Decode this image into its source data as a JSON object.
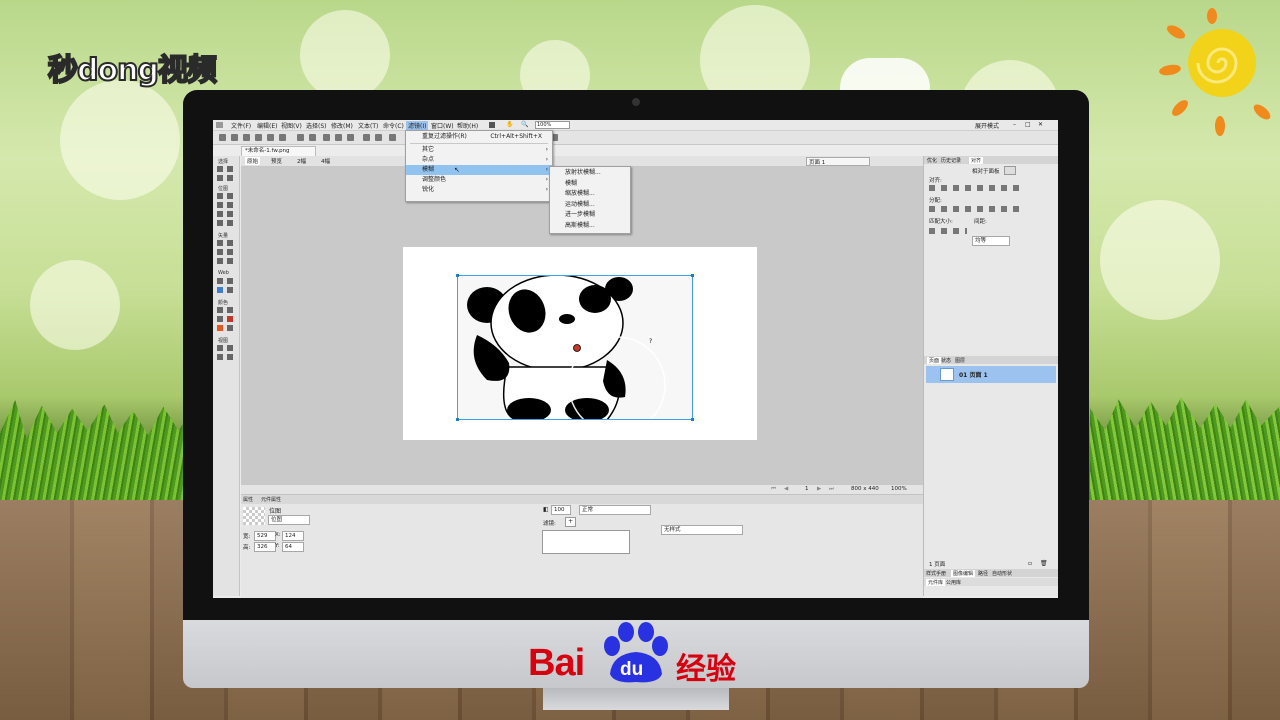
{
  "watermark": {
    "brand_left": "秒dong视频",
    "baidu": "Bai",
    "baidu_du": "du",
    "baidu_suffix": "经验"
  },
  "menubar": {
    "items": [
      "文件(F)",
      "编辑(E)",
      "视图(V)",
      "选择(S)",
      "修改(M)",
      "文本(T)",
      "命令(C)",
      "滤镜(I)",
      "窗口(W)",
      "帮助(H)"
    ],
    "zoom_value": "100%",
    "workspace": "展开模式"
  },
  "document": {
    "tab_title": "*未命名-1.fw.png",
    "view_tabs": [
      "原始",
      "预览",
      "2幅",
      "4幅"
    ],
    "page_label": "页面 1"
  },
  "tools": {
    "sections": [
      "选择",
      "位图",
      "矢量",
      "Web",
      "颜色",
      "视图"
    ]
  },
  "filter_menu": {
    "items": [
      {
        "label": "重复过滤操作(R)",
        "shortcut": "Ctrl+Alt+Shift+X",
        "submenu": false
      },
      {
        "label": "其它",
        "shortcut": "",
        "submenu": true
      },
      {
        "label": "杂点",
        "shortcut": "",
        "submenu": true
      },
      {
        "label": "模糊",
        "shortcut": "",
        "submenu": true,
        "active": true
      },
      {
        "label": "调整颜色",
        "shortcut": "",
        "submenu": true
      },
      {
        "label": "锐化",
        "shortcut": "",
        "submenu": true
      }
    ]
  },
  "blur_submenu": {
    "items": [
      "放射状模糊...",
      "模糊",
      "缩放模糊...",
      "运动模糊...",
      "进一步模糊",
      "高斯模糊..."
    ]
  },
  "status": {
    "page_num": "1",
    "canvas_size": "800 x 440",
    "zoom": "100%"
  },
  "properties": {
    "tabs": [
      "属性",
      "元件属性"
    ],
    "object_type": "位图",
    "object_name": "位图",
    "width_label": "宽:",
    "width": "529",
    "height_label": "高:",
    "height": "326",
    "x_label": "X:",
    "x": "124",
    "y_label": "Y:",
    "y": "64",
    "opacity": "100",
    "blend_mode": "正常",
    "filters_label": "滤镜:",
    "style": "无样式"
  },
  "right_panel": {
    "top_tabs": [
      "优化",
      "历史记录",
      "对齐"
    ],
    "relative_to": "相对于面板",
    "align_label": "对齐:",
    "distribute_label": "分配:",
    "match_size_label": "匹配大小:",
    "spacing_label": "间距:",
    "spacing_value": "均等",
    "pages_tabs": [
      "页面",
      "状态",
      "图层"
    ],
    "page_item": "01 页面 1",
    "page_count": "1 页面",
    "bottom_tabs": [
      "样式手册",
      "图像编辑",
      "路径",
      "自动形状"
    ],
    "bottom_tabs2": [
      "元件库",
      "公用库"
    ]
  },
  "colors": {
    "accent": "#91c3f0",
    "selection": "#3ea2e8",
    "baidu_red": "#d7000f",
    "baidu_blue": "#2932e1"
  }
}
